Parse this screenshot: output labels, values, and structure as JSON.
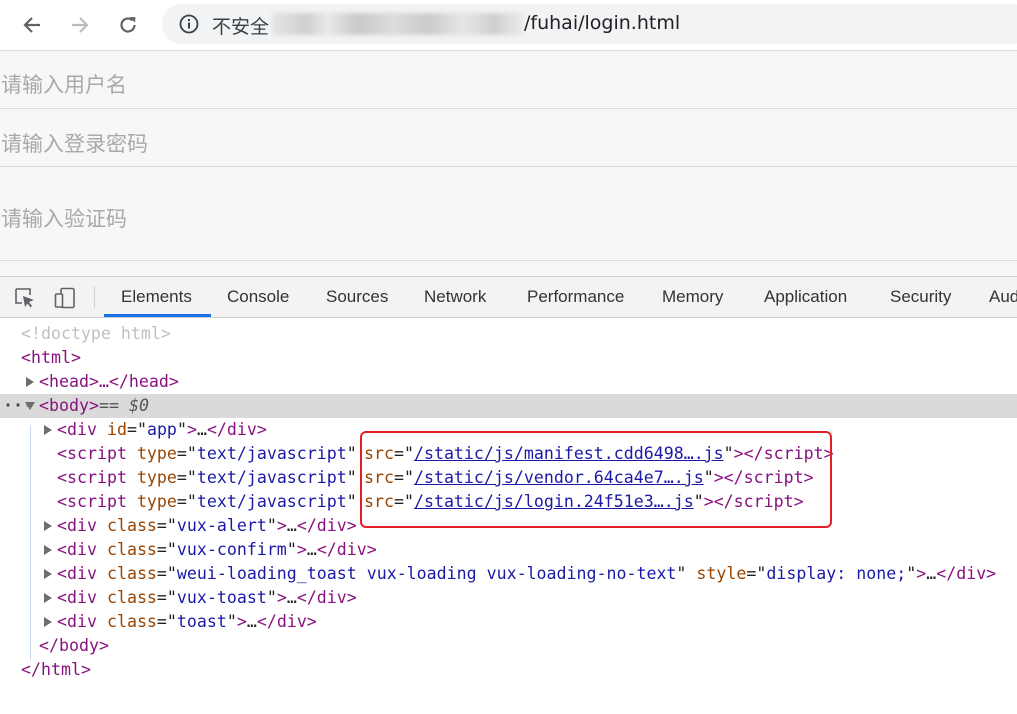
{
  "browser": {
    "url_insecure_label": "不安全",
    "url_path": "/fuhai/login.html",
    "icons": {
      "back": "arrow-left",
      "forward": "arrow-right",
      "reload": "reload",
      "info": "info-circle"
    }
  },
  "page": {
    "username_placeholder": "请输入用户名",
    "password_placeholder": "请输入登录密码",
    "captcha_placeholder": "请输入验证码"
  },
  "devtools": {
    "tabs": [
      "Elements",
      "Console",
      "Sources",
      "Network",
      "Performance",
      "Memory",
      "Application",
      "Security",
      "Aud"
    ],
    "active_tab": "Elements",
    "icons": [
      "inspect-element",
      "device-toolbar"
    ],
    "tree": {
      "doctype": "<!doctype html>",
      "html_open": "<html>",
      "head": "<head>…</head>",
      "body_open": "<body>",
      "body_marker": " == $0",
      "div_app": {
        "tag": "div",
        "attr": "id",
        "val": "app"
      },
      "scripts": [
        {
          "type": "text/javascript",
          "src": "/static/js/manifest.cdd6498….js"
        },
        {
          "type": "text/javascript",
          "src": "/static/js/vendor.64ca4e7….js"
        },
        {
          "type": "text/javascript",
          "src": "/static/js/login.24f51e3….js"
        }
      ],
      "divs": [
        {
          "class": "vux-alert"
        },
        {
          "class": "vux-confirm"
        },
        {
          "class": "weui-loading_toast vux-loading vux-loading-no-text",
          "style": "display: none;"
        },
        {
          "class": "vux-toast"
        },
        {
          "class": "toast"
        }
      ],
      "body_close": "</body>",
      "html_close": "</html>"
    },
    "colors": {
      "tag": "#881280",
      "attr_name": "#994500",
      "attr_value": "#1a1aa6",
      "highlight": "#e51e25",
      "active_tab_underline": "#1a73e8"
    }
  }
}
